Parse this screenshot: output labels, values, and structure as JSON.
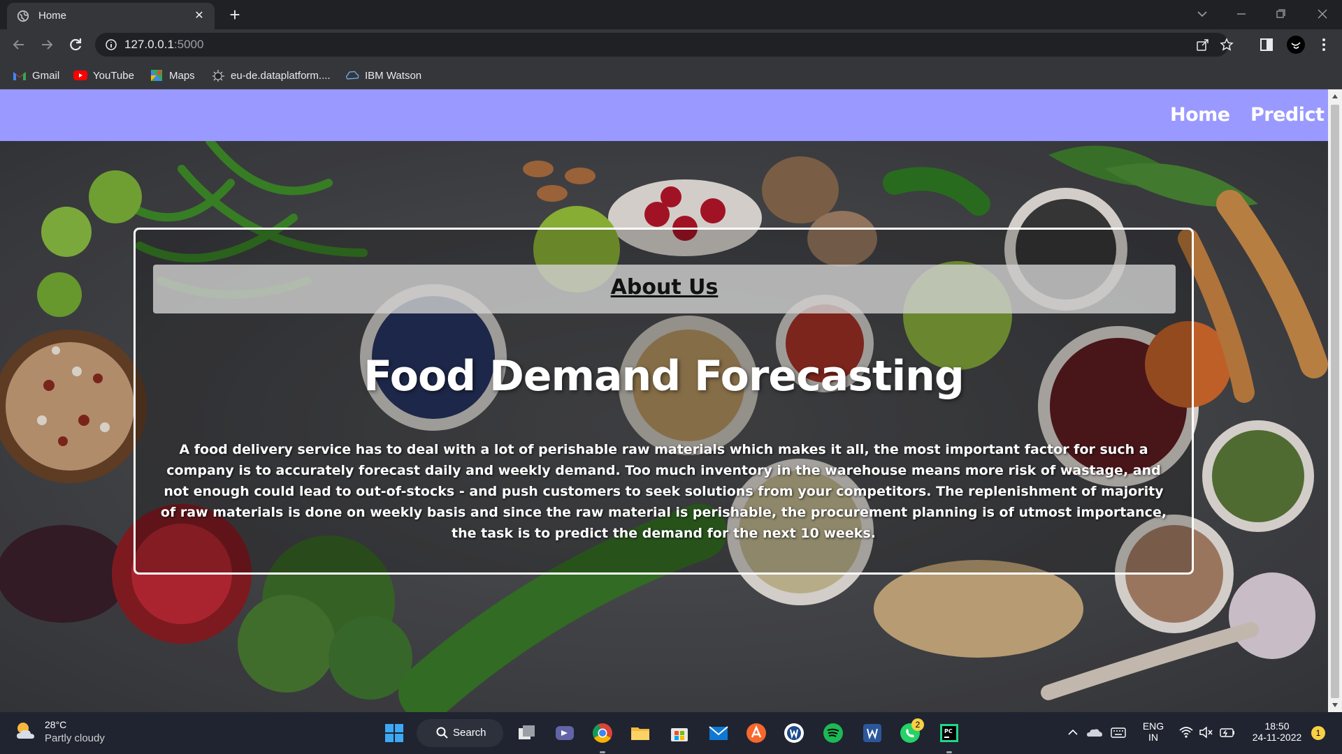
{
  "browser": {
    "tab_title": "Home",
    "url_host": "127.0.0.1",
    "url_port": ":5000",
    "bookmarks": [
      {
        "label": "Gmail",
        "icon": "gmail-icon"
      },
      {
        "label": "YouTube",
        "icon": "youtube-icon"
      },
      {
        "label": "Maps",
        "icon": "maps-icon"
      },
      {
        "label": "eu-de.dataplatform....",
        "icon": "dataplatform-icon"
      },
      {
        "label": "IBM Watson",
        "icon": "ibm-watson-icon"
      }
    ]
  },
  "site": {
    "nav": {
      "home": "Home",
      "predict": "Predict"
    },
    "about_heading": "About Us",
    "headline": "Food Demand Forecasting",
    "description": "A food delivery service has to deal with a lot of perishable raw materials which makes it all, the most important factor for such a company is to accurately forecast daily and weekly demand. Too much inventory in the warehouse means more risk of wastage, and not enough could lead to out-of-stocks - and push customers to seek solutions from your competitors. The replenishment of majority of raw materials is done on weekly basis and since the raw material is perishable, the procurement planning is of utmost importance, the task is to predict the demand for the next 10 weeks.",
    "navbar_color": "#9999ff"
  },
  "taskbar": {
    "weather_temp": "28°C",
    "weather_condition": "Partly cloudy",
    "search_label": "Search",
    "whatsapp_badge": "2",
    "language_line1": "ENG",
    "language_line2": "IN",
    "time": "18:50",
    "date": "24-11-2022",
    "notification_count": "1"
  }
}
